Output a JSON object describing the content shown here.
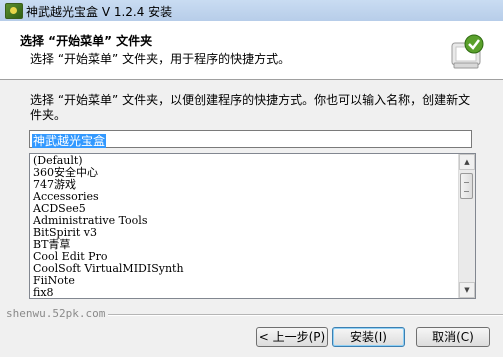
{
  "window": {
    "title": "神武越光宝盒 V 1.2.4 安装"
  },
  "header": {
    "title": "选择 “开始菜单” 文件夹",
    "subtitle": "选择 “开始菜单” 文件夹，用于程序的快捷方式。"
  },
  "main": {
    "description": "选择 “开始菜单” 文件夹，以便创建程序的快捷方式。你也可以输入名称，创建新文件夹。",
    "folder_value": "神武越光宝盒",
    "folders": [
      "(Default)",
      "360安全中心",
      "747游戏",
      "Accessories",
      "ACDSee5",
      "Administrative Tools",
      "BitSpirit v3",
      "BT青草",
      "Cool Edit Pro",
      "CoolSoft VirtualMIDISynth",
      "FiiNote",
      "fix8"
    ]
  },
  "footer": {
    "brand": "shenwu.52pk.com",
    "back_label": "< 上一步(P)",
    "install_label": "安装(I)",
    "cancel_label": "取消(C)"
  },
  "icons": {
    "app": "app-icon",
    "header_logo": "installer-logo-icon",
    "scroll_up": "scroll-up-icon",
    "scroll_down": "scroll-down-icon"
  }
}
